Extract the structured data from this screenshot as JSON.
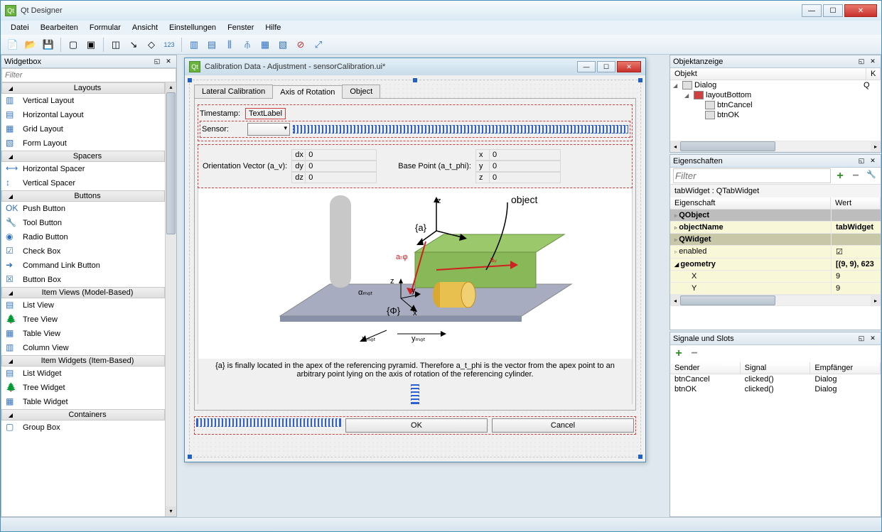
{
  "window": {
    "title": "Qt Designer"
  },
  "menu": {
    "items": [
      "Datei",
      "Bearbeiten",
      "Formular",
      "Ansicht",
      "Einstellungen",
      "Fenster",
      "Hilfe"
    ]
  },
  "widgetbox": {
    "title": "Widgetbox",
    "filter_placeholder": "Filter",
    "categories": [
      {
        "name": "Layouts",
        "items": [
          "Vertical Layout",
          "Horizontal Layout",
          "Grid Layout",
          "Form Layout"
        ]
      },
      {
        "name": "Spacers",
        "items": [
          "Horizontal Spacer",
          "Vertical Spacer"
        ]
      },
      {
        "name": "Buttons",
        "items": [
          "Push Button",
          "Tool Button",
          "Radio Button",
          "Check Box",
          "Command Link Button",
          "Button Box"
        ]
      },
      {
        "name": "Item Views (Model-Based)",
        "items": [
          "List View",
          "Tree View",
          "Table View",
          "Column View"
        ]
      },
      {
        "name": "Item Widgets (Item-Based)",
        "items": [
          "List Widget",
          "Tree Widget",
          "Table Widget"
        ]
      },
      {
        "name": "Containers",
        "items": [
          "Group Box"
        ]
      }
    ]
  },
  "mdi": {
    "title": "Calibration Data - Adjustment - sensorCalibration.ui*",
    "tabs": [
      "Lateral Calibration",
      "Axis of Rotation",
      "Object"
    ],
    "active_tab": 1,
    "timestamp_label": "Timestamp:",
    "timestamp_value": "TextLabel",
    "sensor_label": "Sensor:",
    "orient_label": "Orientation Vector (a_v):",
    "base_label": "Base Point (a_t_phi):",
    "orient": {
      "dx": {
        "lbl": "dx",
        "val": "0"
      },
      "dy": {
        "lbl": "dy",
        "val": "0"
      },
      "dz": {
        "lbl": "dz",
        "val": "0"
      }
    },
    "base": {
      "x": {
        "lbl": "x",
        "val": "0"
      },
      "y": {
        "lbl": "y",
        "val": "0"
      },
      "z": {
        "lbl": "z",
        "val": "0"
      }
    },
    "diagram_labels": {
      "object": "object",
      "a": "{a}",
      "phi": "{Φ}",
      "z": "z",
      "y": "y",
      "x": "x",
      "atphi": "aₜφ",
      "av": "aᵥ",
      "alpha": "αₘₒₜ",
      "xmot": "xₘₒₜ",
      "ymot": "yₘₒₜ"
    },
    "description": "{a} is finally located in the apex of the referencing pyramid. Therefore a_t_phi is the vector from the apex point to an arbitrary point lying on the axis of rotation of the referencing cylinder.",
    "ok": "OK",
    "cancel": "Cancel"
  },
  "object_inspector": {
    "title": "Objektanzeige",
    "col_object": "Objekt",
    "col_class": "K",
    "rows": [
      {
        "indent": 0,
        "name": "Dialog",
        "cls": "Q",
        "exp": true
      },
      {
        "indent": 1,
        "name": "layoutBottom",
        "cls": "",
        "exp": true
      },
      {
        "indent": 2,
        "name": "btnCancel",
        "cls": ""
      },
      {
        "indent": 2,
        "name": "btnOK",
        "cls": ""
      }
    ]
  },
  "properties": {
    "title": "Eigenschaften",
    "filter_placeholder": "Filter",
    "context": "tabWidget : QTabWidget",
    "col_prop": "Eigenschaft",
    "col_val": "Wert",
    "rows": [
      {
        "type": "cat",
        "name": "QObject",
        "cls": ""
      },
      {
        "type": "prop",
        "name": "objectName",
        "val": "tabWidget",
        "bold": true
      },
      {
        "type": "cat",
        "name": "QWidget",
        "cls": "qw"
      },
      {
        "type": "prop",
        "name": "enabled",
        "val": "☑",
        "geo": true
      },
      {
        "type": "prop",
        "name": "geometry",
        "val": "[(9, 9), 623",
        "bold": true,
        "geo": true,
        "exp": true
      },
      {
        "type": "sub",
        "name": "X",
        "val": "9",
        "geo": true
      },
      {
        "type": "sub",
        "name": "Y",
        "val": "9",
        "geo": true
      }
    ]
  },
  "signals": {
    "title": "Signale und Slots",
    "cols": [
      "Sender",
      "Signal",
      "Empfänger"
    ],
    "rows": [
      {
        "sender": "btnCancel",
        "signal": "clicked()",
        "receiver": "Dialog"
      },
      {
        "sender": "btnOK",
        "signal": "clicked()",
        "receiver": "Dialog"
      }
    ]
  }
}
